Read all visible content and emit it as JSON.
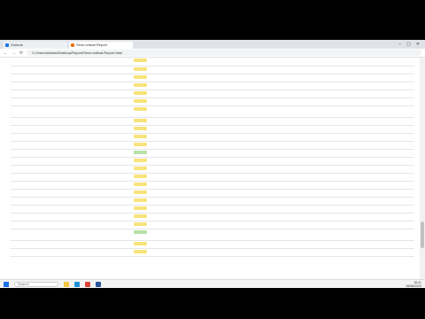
{
  "browser": {
    "tabs": [
      {
        "label": "Outlook"
      },
      {
        "label": "Semi-critical Report"
      }
    ],
    "url": "C:/Users/Admin/Desktop/Report/Semi-critical-Report.html",
    "window_controls": {
      "minimize": "–",
      "maximize": "▢",
      "close": "✕"
    },
    "nav": {
      "back": "←",
      "forward": "→",
      "reload": "⟳"
    }
  },
  "colors": {
    "yellow": "#f7e37a",
    "green": "#b8e0a8",
    "accent": "#1a73e8"
  },
  "rows": [
    {
      "c1": "",
      "c2": "",
      "c3": "",
      "c4": "",
      "c5": ""
    },
    {
      "c1": "",
      "c2": "",
      "c3": "",
      "c4": "",
      "c5": ""
    },
    {
      "c1": "",
      "c2": "",
      "c3": "",
      "c4": "",
      "c5": ""
    },
    {
      "c1": "",
      "c2": "",
      "c3": "",
      "c4": "",
      "c5": ""
    },
    {
      "c1": "",
      "c2": "",
      "c3": "",
      "c4": "",
      "c5": ""
    },
    {
      "c1": "",
      "c2": "",
      "c3": "",
      "c4": "",
      "c5": ""
    },
    {
      "c1": "",
      "c2": "",
      "c3": "",
      "c4": "",
      "c5": ""
    },
    {
      "c1": "",
      "c2": "",
      "c3": "",
      "c4": "",
      "c5": ""
    },
    {
      "c1": "",
      "c2": "",
      "c3": "",
      "c4": "",
      "c5": ""
    },
    {
      "c1": "",
      "c2": "",
      "c3": "",
      "c4": "",
      "c5": ""
    },
    {
      "c1": "",
      "c2": "",
      "c3": "",
      "c4": "",
      "c5": ""
    },
    {
      "c1": "",
      "c2": "",
      "c3": "",
      "c4": "",
      "c5": ""
    },
    {
      "c1": "",
      "c2": "",
      "c3": "",
      "c4": "",
      "c5": ""
    },
    {
      "c1": "",
      "c2": "",
      "c3": "",
      "c4": "",
      "c5": ""
    },
    {
      "c1": "",
      "c2": "",
      "c3": "",
      "c4": "",
      "c5": ""
    },
    {
      "c1": "",
      "c2": "",
      "c3": "",
      "c4": "",
      "c5": ""
    },
    {
      "c1": "",
      "c2": "",
      "c3": "",
      "c4": "",
      "c5": ""
    },
    {
      "c1": "",
      "c2": "",
      "c3": "",
      "c4": "",
      "c5": ""
    },
    {
      "c1": "",
      "c2": "",
      "c3": "",
      "c4": "",
      "c5": ""
    },
    {
      "c1": "",
      "c2": "",
      "c3": "",
      "c4": "",
      "c5": ""
    },
    {
      "c1": "",
      "c2": "",
      "c3": "",
      "c4": "",
      "c5": ""
    },
    {
      "c1": "",
      "c2": "",
      "c3": "",
      "c4": "",
      "c5": ""
    },
    {
      "c1": "",
      "c2": "",
      "c3": "",
      "c4": "",
      "c5": ""
    },
    {
      "c1": "",
      "c2": "",
      "c3": "",
      "c4": "",
      "c5": ""
    }
  ],
  "taskbar": {
    "search_placeholder": "Search",
    "time": "15:21",
    "date": "28/06/2023"
  }
}
